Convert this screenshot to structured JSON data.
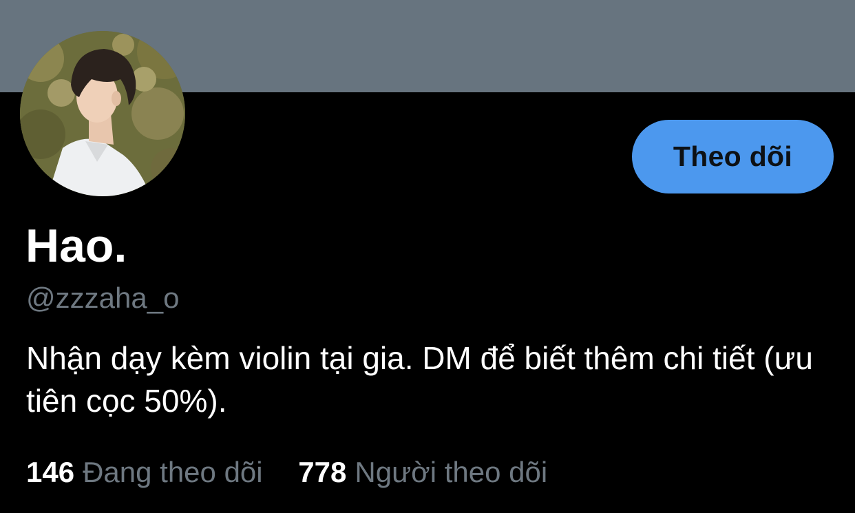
{
  "profile": {
    "display_name": "Hao.",
    "handle": "@zzzaha_o",
    "bio": "Nhận dạy kèm violin tại gia. DM để biết thêm chi tiết (ưu tiên cọc 50%).",
    "follow_button_label": "Theo dõi",
    "stats": {
      "following_count": "146",
      "following_label": "Đang theo dõi",
      "followers_count": "778",
      "followers_label": "Người theo dõi"
    }
  },
  "colors": {
    "banner": "#67747f",
    "background": "#000000",
    "follow_button": "#4c98ee",
    "secondary_text": "#6e7881"
  },
  "icons": {
    "avatar": "profile-photo"
  }
}
